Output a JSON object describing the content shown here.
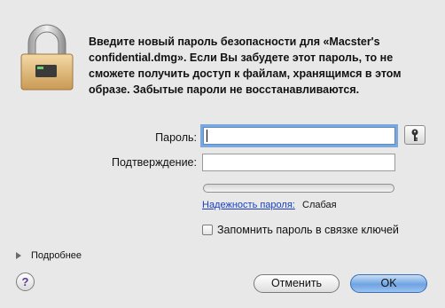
{
  "dialog": {
    "message": "Введите новый пароль безопасности для «Macster's confidential.dmg». Если Вы забудете этот пароль, то не сможете получить доступ к файлам, хранящимся в этом образе. Забытые пароли не восстанавливаются."
  },
  "fields": {
    "password_label": "Пароль:",
    "password_value": "",
    "confirm_label": "Подтверждение:",
    "confirm_value": ""
  },
  "strength": {
    "link_label": "Надежность пароля:",
    "value": "Слабая",
    "level": 0
  },
  "remember": {
    "label": "Запомнить пароль в связке ключей",
    "checked": false
  },
  "details": {
    "label": "Подробнее",
    "expanded": false
  },
  "buttons": {
    "help": "?",
    "cancel": "Отменить",
    "ok": "OK"
  },
  "icons": {
    "lock": "lock-icon",
    "key": "key-icon",
    "disclosure": "disclosure-triangle-icon"
  }
}
